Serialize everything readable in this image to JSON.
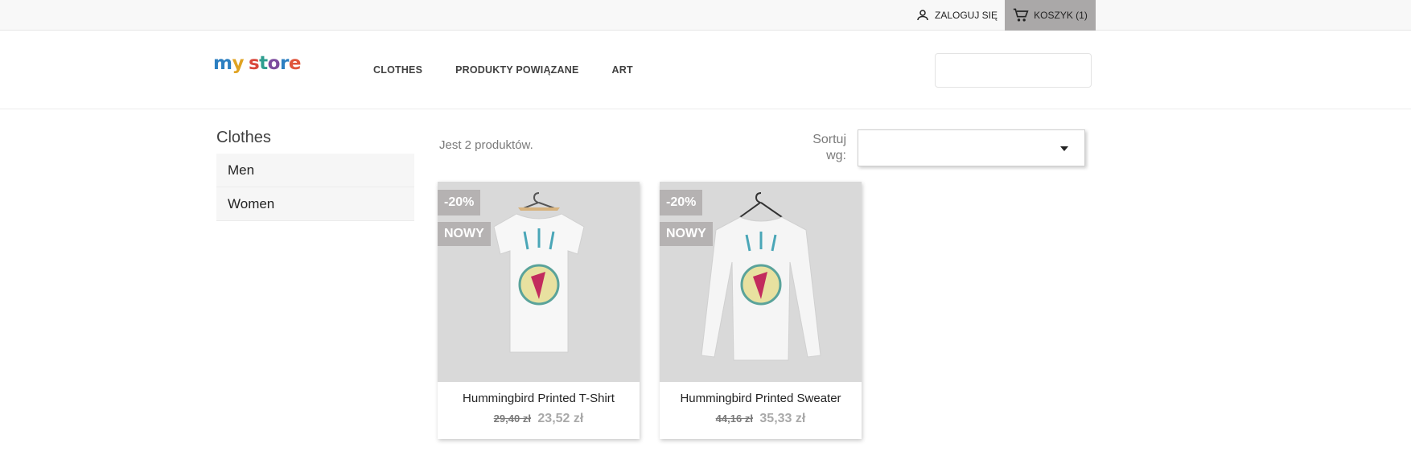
{
  "topbar": {
    "login_label": "ZALOGUJ SIĘ",
    "cart_label": "KOSZYK (1)"
  },
  "header": {
    "logo_text": "my store",
    "menu": [
      "CLOTHES",
      "PRODUKTY POWIĄZANE",
      "ART"
    ]
  },
  "sidebar": {
    "title": "Clothes",
    "items": [
      {
        "label": "Men"
      },
      {
        "label": "Women"
      }
    ]
  },
  "listing": {
    "count_text": "Jest 2 produktów.",
    "sort_label": "Sortuj wg:"
  },
  "products": [
    {
      "name": "Hummingbird Printed T-Shirt",
      "discount": "-20%",
      "flag": "NOWY",
      "old_price": "29,40 zł",
      "price": "23,52 zł"
    },
    {
      "name": "Hummingbird Printed Sweater",
      "discount": "-20%",
      "flag": "NOWY",
      "old_price": "44,16 zł",
      "price": "35,33 zł"
    }
  ],
  "colors": {
    "cart_bg": "#aaa8a8",
    "badge_bg": "#b5b2b2",
    "thumb_bg": "#d9d9d9"
  }
}
